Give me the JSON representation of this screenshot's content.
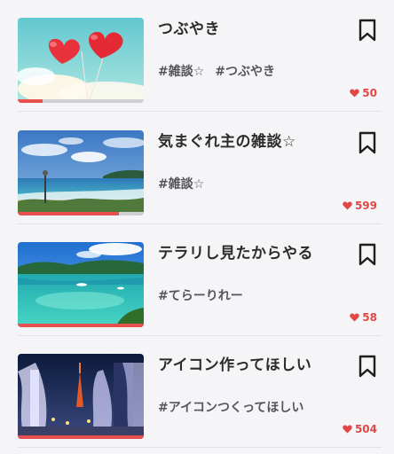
{
  "colors": {
    "accent": "#e8504f",
    "like": "#e04848",
    "title": "#2b2b2b",
    "tag": "#55555c",
    "background": "#f5f5f7"
  },
  "items": [
    {
      "title": "つぶやき",
      "tags": [
        "#雑談☆",
        "#つぶやき"
      ],
      "likes": "50",
      "progress": 0.2,
      "thumbnail": "red-heart-balloons-sky",
      "bookmark_icon": "bookmark-icon",
      "like_icon": "heart-icon"
    },
    {
      "title": "気まぐれ主の雑談☆",
      "tags": [
        "#雑談☆"
      ],
      "likes": "599",
      "progress": 0.8,
      "thumbnail": "ocean-beach",
      "bookmark_icon": "bookmark-icon",
      "like_icon": "heart-icon"
    },
    {
      "title": "テラリし見たからやる",
      "tags": [
        "#てらーりれー"
      ],
      "likes": "58",
      "progress": 1.0,
      "thumbnail": "tropical-lagoon",
      "bookmark_icon": "bookmark-icon",
      "like_icon": "heart-icon"
    },
    {
      "title": "アイコン作ってほしい",
      "tags": [
        "#アイコンつくってほしい"
      ],
      "likes": "504",
      "progress": 1.0,
      "thumbnail": "tokyo-tower-illumination",
      "bookmark_icon": "bookmark-icon",
      "like_icon": "heart-icon"
    }
  ]
}
